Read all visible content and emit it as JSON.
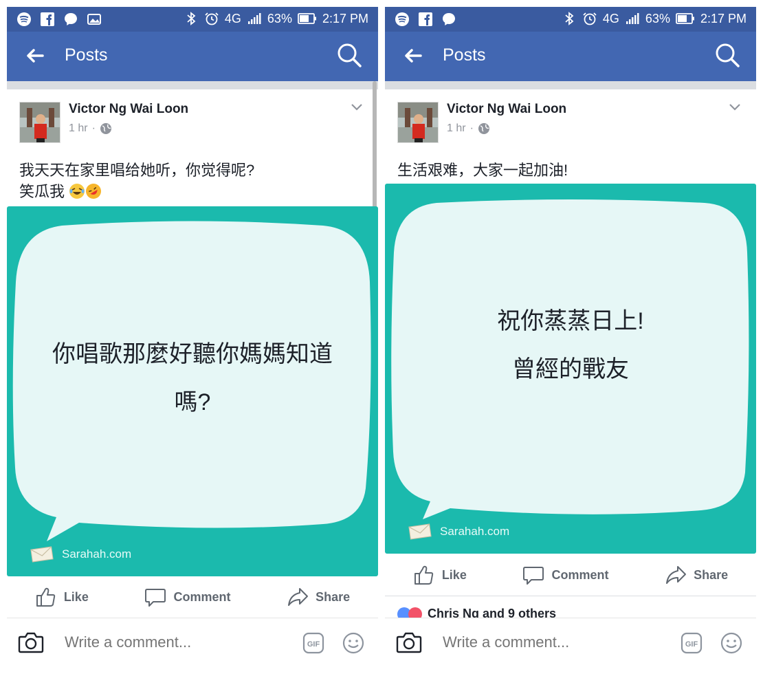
{
  "status_bar": {
    "network": "4G",
    "battery": "63%",
    "time": "2:17 PM"
  },
  "nav": {
    "title": "Posts"
  },
  "posts": [
    {
      "author": "Victor Ng Wai Loon",
      "time": "1 hr",
      "text_line1": "我天天在家里唱给她听，你觉得呢?",
      "text_line2": "笑瓜我",
      "card_line1": "你唱歌那麼好聽你媽媽知道",
      "card_line2": "嗎?",
      "card_site": "Sarahah.com"
    },
    {
      "author": "Victor Ng Wai Loon",
      "time": "1 hr",
      "text_line1": "生活艰难，大家一起加油!",
      "card_line1": "祝你蒸蒸日上!",
      "card_line2": "曾經的戰友",
      "card_site": "Sarahah.com",
      "reactions_text": "Chris Ng and 9 others"
    }
  ],
  "actions": {
    "like": "Like",
    "comment": "Comment",
    "share": "Share"
  },
  "comment_bar": {
    "placeholder": "Write a comment..."
  },
  "colors": {
    "status_bar": "#3a5ba0",
    "nav_bar": "#4267b2",
    "card_teal": "#1bbaad",
    "bubble_fill": "#e6f7f6"
  }
}
